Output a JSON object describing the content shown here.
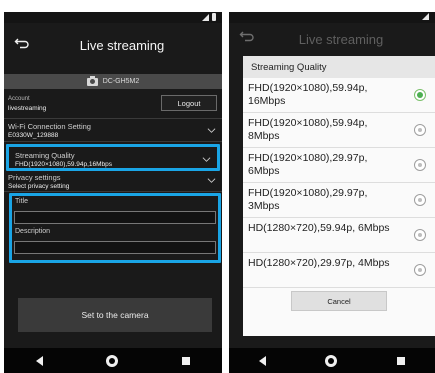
{
  "left": {
    "title": "Live streaming",
    "camera_name": "DC-GH5M2",
    "account": {
      "label": "Account",
      "value": "livestreaming",
      "logout_label": "Logout"
    },
    "wifi": {
      "label": "Wi-Fi Connection Setting",
      "value": "E0330W_129888"
    },
    "streaming_quality": {
      "label": "Streaming Quality",
      "value": "FHD(1920×1080),59.94p,16Mbps"
    },
    "privacy": {
      "label": "Privacy settings",
      "value": "Select privacy setting"
    },
    "title_field": {
      "label": "Title",
      "value": ""
    },
    "description_field": {
      "label": "Description",
      "value": ""
    },
    "set_button": "Set to the camera"
  },
  "right": {
    "bg_title": "Live streaming",
    "dialog_title": "Streaming Quality",
    "options": [
      {
        "label": "FHD(1920×1080),59.94p, 16Mbps",
        "selected": true
      },
      {
        "label": "FHD(1920×1080),59.94p, 8Mbps",
        "selected": false
      },
      {
        "label": "FHD(1920×1080),29.97p, 6Mbps",
        "selected": false
      },
      {
        "label": "FHD(1920×1080),29.97p, 3Mbps",
        "selected": false
      },
      {
        "label": "HD(1280×720),59.94p, 6Mbps",
        "selected": false
      },
      {
        "label": "HD(1280×720),29.97p, 4Mbps",
        "selected": false
      }
    ],
    "cancel_label": "Cancel"
  },
  "colors": {
    "highlight": "#1aa5e6",
    "radio_selected": "#4caf50"
  }
}
